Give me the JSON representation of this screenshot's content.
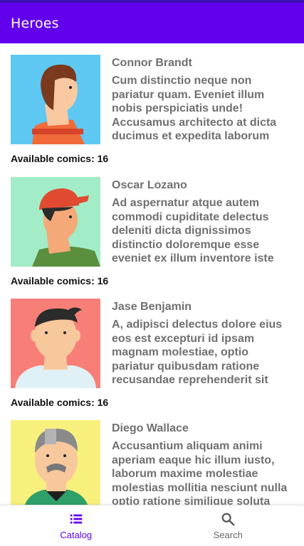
{
  "app": {
    "title": "Heroes"
  },
  "heroes": [
    {
      "name": "Connor Brandt",
      "description": "Cum distinctio neque non pariatur quam. Eveniet illum nobis perspiciatis unde! Accusamus architecto at dicta ducimus et expedita laborum",
      "comics": "Available comics: 16",
      "avatar_bg": "#5ec7f2"
    },
    {
      "name": "Oscar Lozano",
      "description": "Ad aspernatur atque autem commodi cupiditate delectus deleniti dicta dignissimos distinctio doloremque esse eveniet ex illum inventore iste",
      "comics": "Available comics: 16",
      "avatar_bg": "#a3ecc8"
    },
    {
      "name": "Jase Benjamin",
      "description": "A, adipisci delectus dolore eius eos est excepturi id ipsam magnam molestiae, optio pariatur quibusdam ratione recusandae reprehenderit sit",
      "comics": "Available comics: 16",
      "avatar_bg": "#f77f78"
    },
    {
      "name": "Diego Wallace",
      "description": "Accusantium aliquam animi aperiam eaque hic illum iusto, laborum maxime molestiae molestias mollitia nesciunt nulla optio ratione similique soluta",
      "comics": "",
      "avatar_bg": "#f7f07c"
    }
  ],
  "bottom_nav": {
    "catalog": {
      "label": "Catalog",
      "icon": "list-icon",
      "active": true
    },
    "search": {
      "label": "Search",
      "icon": "search-icon",
      "active": false
    }
  },
  "colors": {
    "primary": "#6200ee",
    "text_secondary": "#707070"
  }
}
